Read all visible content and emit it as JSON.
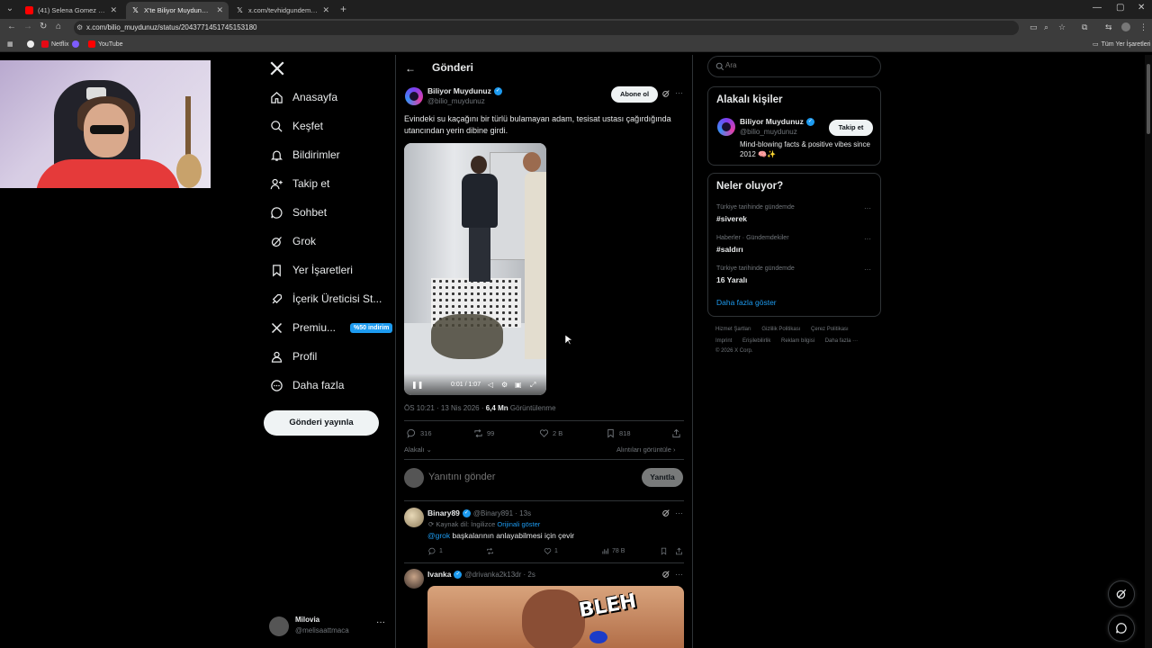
{
  "browser": {
    "tabs": [
      {
        "title": "(41) Selena Gomez - People You...",
        "favicon": "youtube-icon",
        "active": false
      },
      {
        "title": "X'te Biliyor Muydunuz: \"Evi...",
        "favicon": "x-icon",
        "active": true
      },
      {
        "title": "x.com/tevhidgundemi/status/2...",
        "favicon": "x-icon",
        "active": false
      }
    ],
    "url": "x.com/bilio_muydunuz/status/2043771451745153180",
    "bookmarks": [
      {
        "label": "Netflix",
        "color": "#e50914"
      },
      {
        "label": "YouTube",
        "color": "#ff0000"
      }
    ],
    "all_bookmarks_label": "Tüm Yer İşaretleri"
  },
  "sidebar": {
    "items": [
      {
        "label": "Anasayfa",
        "icon": "home-icon"
      },
      {
        "label": "Keşfet",
        "icon": "search-icon"
      },
      {
        "label": "Bildirimler",
        "icon": "bell-icon"
      },
      {
        "label": "Takip et",
        "icon": "add-user-icon"
      },
      {
        "label": "Sohbet",
        "icon": "chat-icon"
      },
      {
        "label": "Grok",
        "icon": "grok-icon"
      },
      {
        "label": "Yer İşaretleri",
        "icon": "bookmark-icon"
      },
      {
        "label": "İçerik Üreticisi St...",
        "icon": "rocket-icon"
      },
      {
        "label": "Premiu...",
        "icon": "x-icon"
      },
      {
        "label": "Profil",
        "icon": "profile-icon"
      },
      {
        "label": "Daha fazla",
        "icon": "more-circle-icon"
      }
    ],
    "premium_badge": "%50 indirim",
    "post_button": "Gönderi yayınla",
    "account": {
      "name": "Milovia",
      "handle": "@melisaattmaca"
    }
  },
  "main": {
    "title": "Gönderi",
    "post": {
      "author": "Biliyor Muydunuz",
      "handle": "@bilio_muydunuz",
      "subscribe": "Abone ol",
      "text": "Evindeki su kaçağını bir türlü bulamayan adam, tesisat ustası çağırdığında utancından yerin dibine girdi.",
      "video_time": "0:01 / 1:07",
      "timestamp": "ÖS 10:21 · 13 Nis 2026 · ",
      "views_count": "6,4 Mn",
      "views_label": " Görüntülenme",
      "stats": {
        "replies": "316",
        "reposts": "99",
        "likes": "2 B",
        "bookmarks": "818"
      },
      "related_label": "Alakalı",
      "quotes_label": "Alıntıları görüntüle"
    },
    "reply_box": {
      "placeholder": "Yanıtını gönder",
      "button": "Yanıtla"
    },
    "replies": [
      {
        "name": "Binary89",
        "handle": "@Binary891 · 13s",
        "source_label": "Kaynak dil: İngilizce",
        "source_link": "Orijinali göster",
        "mention": "@grok",
        "text": " başkalarının anlayabilmesi için çevir",
        "stats": {
          "replies": "1",
          "likes": "1",
          "views": "78 B"
        }
      },
      {
        "name": "Ivanka",
        "handle": "@drivanka2k13dr · 2s",
        "gif_caption": "BLEH"
      }
    ]
  },
  "right": {
    "search_placeholder": "Ara",
    "related": {
      "title": "Alakalı kişiler",
      "name": "Biliyor Muydunuz",
      "handle": "@bilio_muydunuz",
      "bio": "Mind-blowing facts & positive vibes since 2012 🧠✨",
      "follow": "Takip et"
    },
    "trends": {
      "title": "Neler oluyor?",
      "items": [
        {
          "context": "Türkiye tarihinde gündemde",
          "name": "#siverek"
        },
        {
          "context": "Haberler · Gündemdekiler",
          "name": "#saldırı"
        },
        {
          "context": "Türkiye tarihinde gündemde",
          "name": "16 Yaralı"
        }
      ],
      "show_more": "Daha fazla göster"
    },
    "footer": {
      "line1": [
        "Hizmet Şartları",
        "Gizlilik Politikası",
        "Çerez Politikası"
      ],
      "line2": [
        "Imprint",
        "Erişilebilirlik",
        "Reklam bilgisi",
        "Daha fazla ···"
      ],
      "line3": "© 2026 X Corp."
    }
  },
  "colors": {
    "accent": "#1d9bf0",
    "background": "#000000",
    "border": "#2f3336"
  }
}
